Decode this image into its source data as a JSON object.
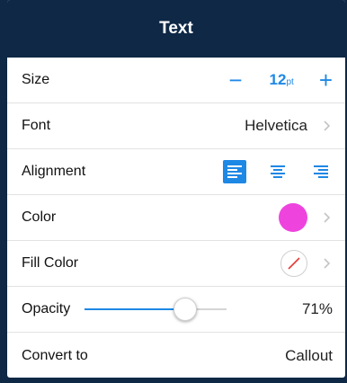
{
  "header": {
    "title": "Text"
  },
  "rows": {
    "size": {
      "label": "Size",
      "value": "12",
      "unit": "pt",
      "minus": "−",
      "plus": "+"
    },
    "font": {
      "label": "Font",
      "value": "Helvetica"
    },
    "alignment": {
      "label": "Alignment",
      "options": [
        "left",
        "center",
        "right"
      ],
      "selected": "left"
    },
    "color": {
      "label": "Color",
      "swatch": "#ee44dd"
    },
    "fill_color": {
      "label": "Fill Color",
      "swatch": "none"
    },
    "opacity": {
      "label": "Opacity",
      "value": "71%",
      "level": 0.71
    },
    "convert": {
      "label": "Convert to",
      "value": "Callout"
    }
  },
  "colors": {
    "accent": "#1e88e5",
    "header_bg": "#0e2846",
    "text_swatch": "#ee44dd",
    "no_fill_slash": "#e53935"
  },
  "icons": [
    "chevron-right-icon",
    "align-left-icon",
    "align-center-icon",
    "align-right-icon"
  ]
}
